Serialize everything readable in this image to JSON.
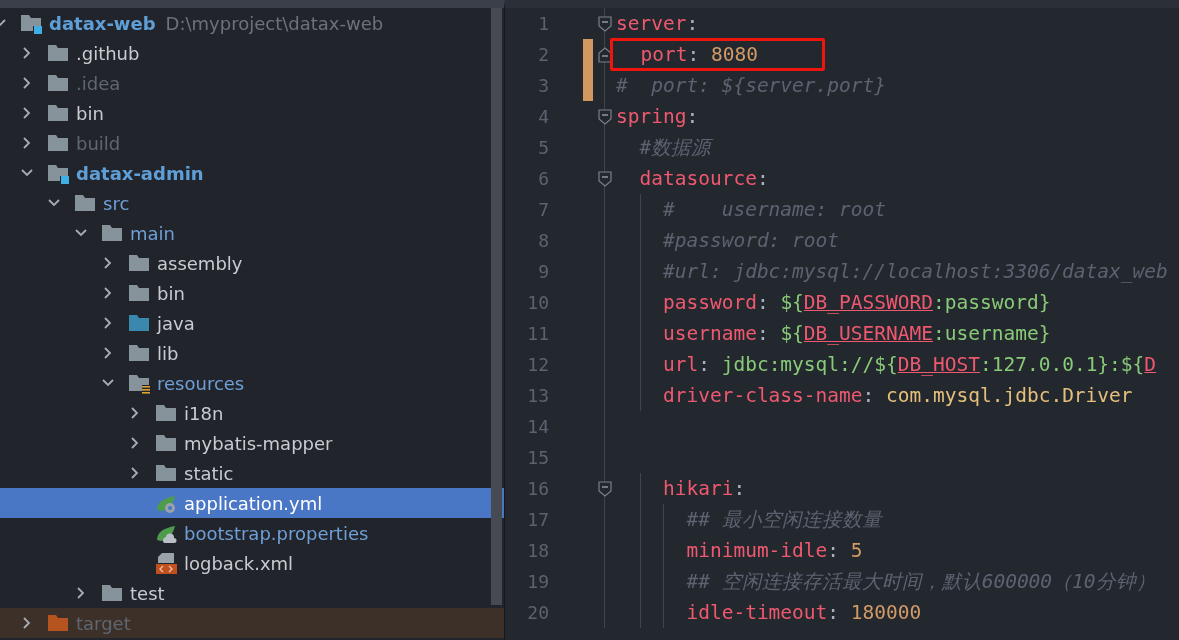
{
  "project_tree": {
    "root": {
      "label": "datax-web",
      "path": "D:\\myproject\\datax-web",
      "kind": "module",
      "color": "#5f9fd8",
      "expanded": true,
      "selected": false,
      "children": [
        {
          "label": ".github",
          "kind": "folder",
          "color": "#c8ccd2",
          "expanded": false,
          "selected": false
        },
        {
          "label": ".idea",
          "kind": "folder",
          "color": "#5f6670",
          "expanded": false,
          "selected": false
        },
        {
          "label": "bin",
          "kind": "folder",
          "color": "#c8ccd2",
          "expanded": false,
          "selected": false
        },
        {
          "label": "build",
          "kind": "folder",
          "color": "#5f6670",
          "expanded": false,
          "selected": false
        },
        {
          "label": "datax-admin",
          "kind": "module",
          "color": "#5f9fd8",
          "expanded": true,
          "selected": false,
          "children": [
            {
              "label": "src",
              "kind": "folder",
              "color": "#6f9fd6",
              "expanded": true,
              "selected": false,
              "children": [
                {
                  "label": "main",
                  "kind": "folder",
                  "color": "#6f9fd6",
                  "expanded": true,
                  "selected": false,
                  "children": [
                    {
                      "label": "assembly",
                      "kind": "folder",
                      "color": "#c8ccd2",
                      "expanded": false,
                      "selected": false
                    },
                    {
                      "label": "bin",
                      "kind": "folder",
                      "color": "#c8ccd2",
                      "expanded": false,
                      "selected": false
                    },
                    {
                      "label": "java",
                      "kind": "source-folder",
                      "color": "#c8ccd2",
                      "expanded": false,
                      "selected": false
                    },
                    {
                      "label": "lib",
                      "kind": "folder",
                      "color": "#c8ccd2",
                      "expanded": false,
                      "selected": false
                    },
                    {
                      "label": "resources",
                      "kind": "resources",
                      "color": "#6f9fd6",
                      "expanded": true,
                      "selected": false,
                      "children": [
                        {
                          "label": "i18n",
                          "kind": "folder",
                          "color": "#c8ccd2",
                          "expanded": false,
                          "selected": false
                        },
                        {
                          "label": "mybatis-mapper",
                          "kind": "folder",
                          "color": "#c8ccd2",
                          "expanded": false,
                          "selected": false
                        },
                        {
                          "label": "static",
                          "kind": "folder",
                          "color": "#c8ccd2",
                          "expanded": false,
                          "selected": false
                        },
                        {
                          "label": "application.yml",
                          "kind": "yaml",
                          "color": "#ffffff",
                          "selected": true
                        },
                        {
                          "label": "bootstrap.properties",
                          "kind": "properties",
                          "color": "#6f9fd6",
                          "selected": false
                        },
                        {
                          "label": "logback.xml",
                          "kind": "xml",
                          "color": "#c8ccd2",
                          "selected": false
                        }
                      ]
                    }
                  ]
                },
                {
                  "label": "test",
                  "kind": "folder",
                  "color": "#c8ccd2",
                  "expanded": false,
                  "selected": false
                }
              ]
            }
          ]
        },
        {
          "label": "target",
          "kind": "excluded",
          "color": "#5f6670",
          "expanded": false,
          "selected": false
        }
      ]
    }
  },
  "editor": {
    "lines": [
      {
        "number": "1",
        "fold_start": true,
        "fold_end": false,
        "changed": false,
        "boxed": false,
        "tokens": [
          {
            "kind": "key",
            "text": "server"
          },
          {
            "kind": "punct",
            "text": ":"
          }
        ]
      },
      {
        "number": "2",
        "fold_start": false,
        "fold_end": true,
        "changed": true,
        "boxed": true,
        "tokens": [
          {
            "kind": "key",
            "text": "  port"
          },
          {
            "kind": "punct",
            "text": ": "
          },
          {
            "kind": "number",
            "text": "8080"
          }
        ]
      },
      {
        "number": "3",
        "changed": true,
        "boxed": false,
        "tokens": [
          {
            "kind": "comment",
            "text": "#  port: ${server.port}"
          }
        ]
      },
      {
        "number": "4",
        "fold_start": true,
        "fold_end": false,
        "changed": false,
        "boxed": false,
        "tokens": [
          {
            "kind": "key",
            "text": "spring"
          },
          {
            "kind": "punct",
            "text": ":"
          }
        ]
      },
      {
        "number": "5",
        "changed": false,
        "boxed": false,
        "tokens": [
          {
            "kind": "comment",
            "text": "  #数据源"
          }
        ]
      },
      {
        "number": "6",
        "fold_start": true,
        "fold_end": false,
        "changed": false,
        "boxed": false,
        "tokens": [
          {
            "kind": "key",
            "text": "  datasource"
          },
          {
            "kind": "punct",
            "text": ":"
          }
        ]
      },
      {
        "number": "7",
        "changed": false,
        "boxed": false,
        "tokens": [
          {
            "kind": "comment",
            "text": "    #    username: root"
          }
        ]
      },
      {
        "number": "8",
        "changed": false,
        "boxed": false,
        "tokens": [
          {
            "kind": "comment",
            "text": "    #password: root"
          }
        ]
      },
      {
        "number": "9",
        "changed": false,
        "boxed": false,
        "tokens": [
          {
            "kind": "comment",
            "text": "    #url: jdbc:mysql://localhost:3306/datax_web"
          }
        ]
      },
      {
        "number": "10",
        "changed": false,
        "boxed": false,
        "tokens": [
          {
            "kind": "key",
            "text": "    password"
          },
          {
            "kind": "punct",
            "text": ": "
          },
          {
            "kind": "value",
            "text": "${"
          },
          {
            "kind": "ref",
            "text": "DB_PASSWORD"
          },
          {
            "kind": "value",
            "text": ":password}"
          }
        ]
      },
      {
        "number": "11",
        "changed": false,
        "boxed": false,
        "tokens": [
          {
            "kind": "key",
            "text": "    username"
          },
          {
            "kind": "punct",
            "text": ": "
          },
          {
            "kind": "value",
            "text": "${"
          },
          {
            "kind": "ref",
            "text": "DB_USERNAME"
          },
          {
            "kind": "value",
            "text": ":username}"
          }
        ]
      },
      {
        "number": "12",
        "changed": false,
        "boxed": false,
        "tokens": [
          {
            "kind": "key",
            "text": "    url"
          },
          {
            "kind": "punct",
            "text": ": "
          },
          {
            "kind": "value",
            "text": "jdbc:mysql://${"
          },
          {
            "kind": "ref",
            "text": "DB_HOST"
          },
          {
            "kind": "value",
            "text": ":127.0.0.1}:${"
          },
          {
            "kind": "ref",
            "text": "D"
          }
        ]
      },
      {
        "number": "13",
        "changed": false,
        "boxed": false,
        "tokens": [
          {
            "kind": "key",
            "text": "    driver-class-name"
          },
          {
            "kind": "punct",
            "text": ": "
          },
          {
            "kind": "string",
            "text": "com.mysql.jdbc.Driver"
          }
        ]
      },
      {
        "number": "14",
        "changed": false,
        "boxed": false
      },
      {
        "number": "15",
        "changed": false,
        "boxed": false
      },
      {
        "number": "16",
        "fold_start": true,
        "fold_end": false,
        "changed": false,
        "boxed": false,
        "tokens": [
          {
            "kind": "key",
            "text": "    hikari"
          },
          {
            "kind": "punct",
            "text": ":"
          }
        ]
      },
      {
        "number": "17",
        "changed": false,
        "boxed": false,
        "tokens": [
          {
            "kind": "comment",
            "text": "      ## 最小空闲连接数量"
          }
        ]
      },
      {
        "number": "18",
        "changed": false,
        "boxed": false,
        "tokens": [
          {
            "kind": "key",
            "text": "      minimum-idle"
          },
          {
            "kind": "punct",
            "text": ": "
          },
          {
            "kind": "number",
            "text": "5"
          }
        ]
      },
      {
        "number": "19",
        "changed": false,
        "boxed": false,
        "tokens": [
          {
            "kind": "comment",
            "text": "      ## 空闲连接存活最大时间，默认600000（10分钟）"
          }
        ]
      },
      {
        "number": "20",
        "changed": false,
        "boxed": false,
        "tokens": [
          {
            "kind": "key",
            "text": "      idle-timeout"
          },
          {
            "kind": "punct",
            "text": ": "
          },
          {
            "kind": "number",
            "text": "180000"
          }
        ]
      }
    ]
  }
}
